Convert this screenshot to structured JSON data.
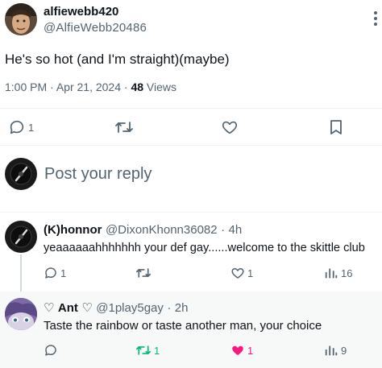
{
  "post": {
    "display_name": "alfiewebb420",
    "handle": "@AlfieWebb20486",
    "text": "He's so hot (and I'm straight)(maybe)",
    "time": "1:00 PM",
    "separator": "·",
    "date": "Apr 21, 2024",
    "views_count": "48",
    "views_label": "Views",
    "reply_count": "1"
  },
  "composer": {
    "placeholder": "Post your reply"
  },
  "replies": [
    {
      "display_name": "(K)honnor",
      "handle": "@DixonKhonn36082",
      "separator": "·",
      "age": "4h",
      "text": "yeaaaaaahhhhhhh your def gay......welcome to the skittle club",
      "reply_count": "1",
      "like_count": "1",
      "view_count": "16"
    },
    {
      "name_prefix": "♡",
      "display_name": "Ant",
      "name_suffix": "♡",
      "handle": "@1play5gay",
      "separator": "·",
      "age": "2h",
      "text": "Taste the rainbow or taste another man, your choice",
      "repost_count": "1",
      "like_count": "1",
      "view_count": "9"
    }
  ],
  "colors": {
    "text": "#0f1419",
    "secondary": "#536471",
    "repost_active": "#00ba7c",
    "like_active": "#f91880",
    "highlight_bg": "#f7f9f9"
  }
}
